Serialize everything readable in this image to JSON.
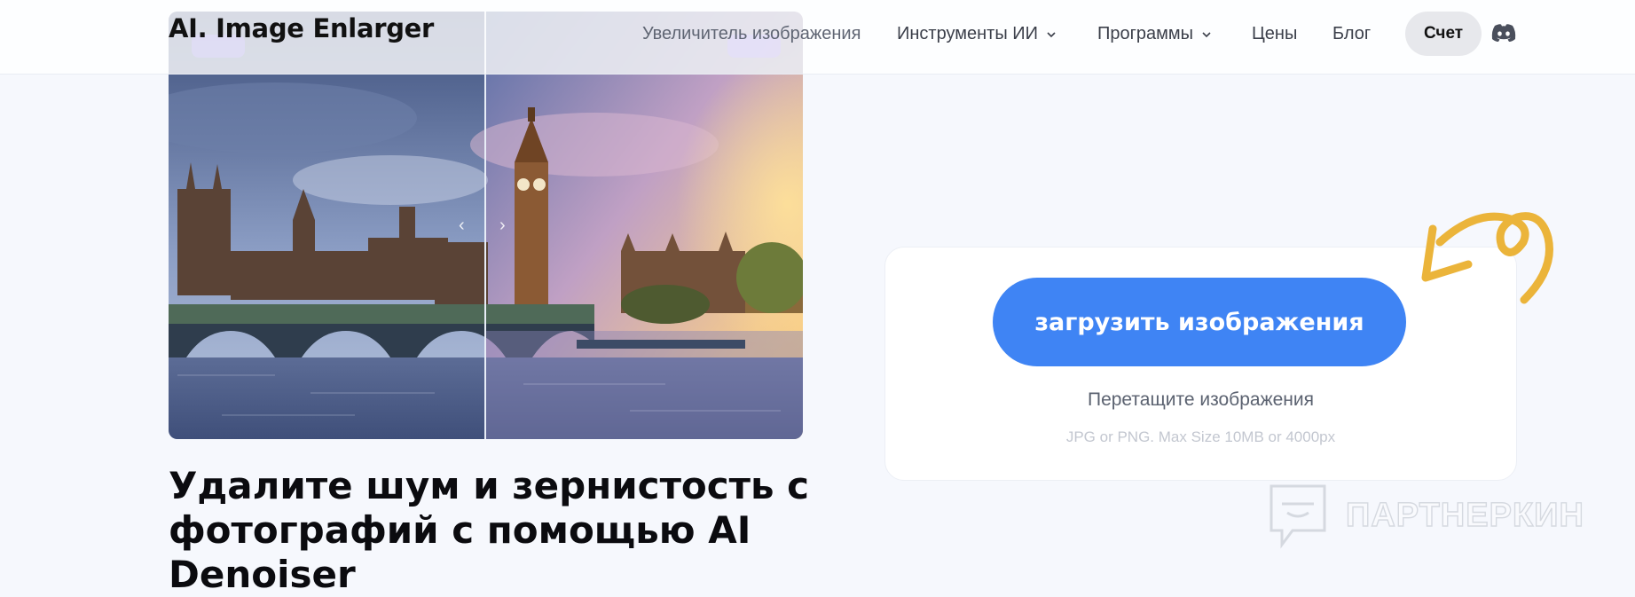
{
  "header": {
    "logo": "AI. Image Enlarger",
    "nav": [
      {
        "label": "Увеличитель изображения",
        "has_dropdown": false
      },
      {
        "label": "Инструменты ИИ",
        "has_dropdown": true
      },
      {
        "label": "Программы",
        "has_dropdown": true
      },
      {
        "label": "Цены",
        "has_dropdown": false
      },
      {
        "label": "Блог",
        "has_dropdown": false
      }
    ],
    "account_label": "Счет",
    "discord_icon": "discord-icon"
  },
  "preview": {
    "image_subject": "Big Ben and Westminster Palace over the Thames, before/after comparison",
    "left_arrow": "‹",
    "right_arrow": "›"
  },
  "headline": "Удалите шум и зернистость с фотографий с помощью AI Denoiser",
  "upload": {
    "button_label": "загрузить изображения",
    "drag_text": "Перетащите изображения",
    "format_text": "JPG or PNG. Max Size 10MB or 4000px"
  },
  "watermark": "ПАРТНЕРКИН",
  "colors": {
    "accent": "#3f84f4",
    "background": "#f6f8fd",
    "arrow_doodle": "#ebb43a"
  }
}
